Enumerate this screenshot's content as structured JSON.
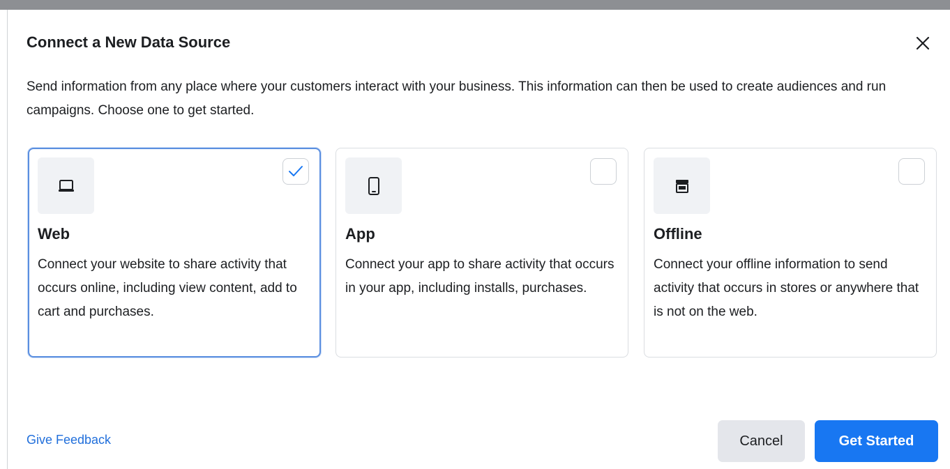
{
  "dialog": {
    "title": "Connect a New Data Source",
    "description": "Send information from any place where your customers interact with your business. This information can then be used to create audiences and run campaigns. Choose one to get started."
  },
  "sources": [
    {
      "title": "Web",
      "description": "Connect your website to share activity that occurs online, including view content, add to cart and purchases.",
      "icon": "laptop-icon",
      "selected": true
    },
    {
      "title": "App",
      "description": "Connect your app to share activity that occurs in your app, including installs, purchases.",
      "icon": "mobile-phone-icon",
      "selected": false
    },
    {
      "title": "Offline",
      "description": "Connect your offline information to send activity that occurs in stores or anywhere that is not on the web.",
      "icon": "store-icon",
      "selected": false
    }
  ],
  "footer": {
    "feedback_label": "Give Feedback",
    "cancel_label": "Cancel",
    "primary_label": "Get Started"
  },
  "colors": {
    "accent": "#1877f2",
    "link": "#216fdb",
    "selected_border": "#5b8fe0"
  }
}
